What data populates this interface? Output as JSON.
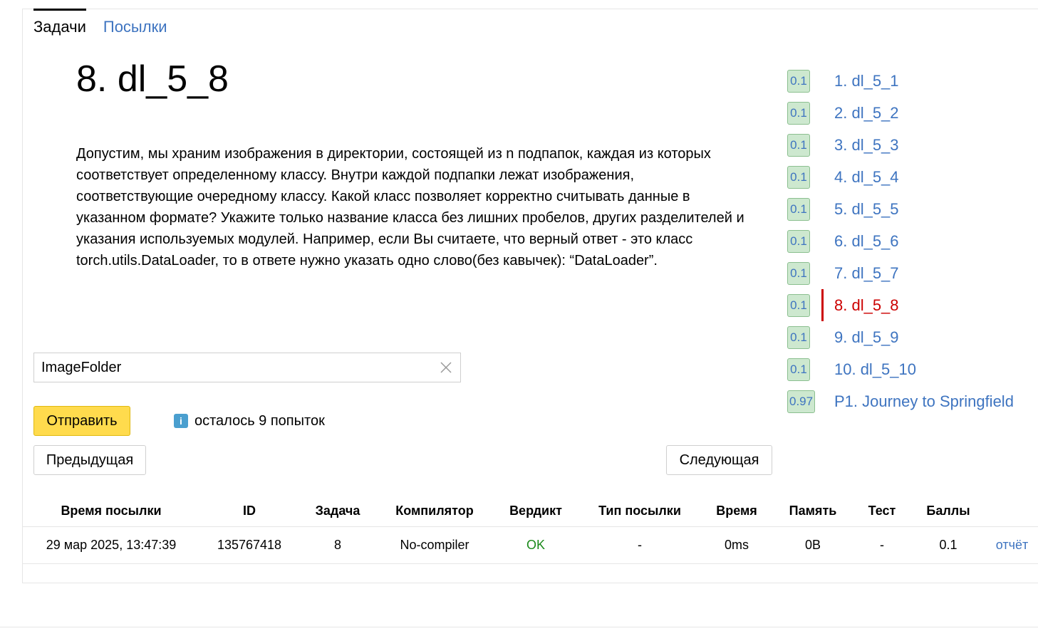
{
  "tabs": {
    "problems": "Задачи",
    "submissions": "Посылки"
  },
  "problem": {
    "title": "8. dl_5_8",
    "statement": "Допустим, мы храним изображения в директории, состоящей из n подпапок, каждая из которых соответствует определенному классу. Внутри каждой подпапки лежат изображения, соответствующие очередному классу. Какой класс позволяет корректно считывать данные в указанном формате? Укажите только название класса без лишних пробелов, других разделителей и указания используемых модулей. Например, если Вы считаете, что верный ответ - это класс torch.utils.DataLoader, то в ответе нужно указать одно слово(без кавычек): “DataLoader”."
  },
  "answer": {
    "value": "ImageFolder"
  },
  "actions": {
    "submit_label": "Отправить",
    "attempts_text": "осталось 9 попыток",
    "prev_label": "Предыдущая",
    "next_label": "Следующая"
  },
  "sidebar": {
    "items": [
      {
        "score": "0.1",
        "label": "1. dl_5_1"
      },
      {
        "score": "0.1",
        "label": "2. dl_5_2"
      },
      {
        "score": "0.1",
        "label": "3. dl_5_3"
      },
      {
        "score": "0.1",
        "label": "4. dl_5_4"
      },
      {
        "score": "0.1",
        "label": "5. dl_5_5"
      },
      {
        "score": "0.1",
        "label": "6. dl_5_6"
      },
      {
        "score": "0.1",
        "label": "7. dl_5_7"
      },
      {
        "score": "0.1",
        "label": "8. dl_5_8",
        "current": true
      },
      {
        "score": "0.1",
        "label": "9. dl_5_9"
      },
      {
        "score": "0.1",
        "label": "10. dl_5_10"
      },
      {
        "score": "0.97",
        "label": "P1. Journey to Springfield"
      }
    ]
  },
  "table": {
    "headers": [
      "Время посылки",
      "ID",
      "Задача",
      "Компилятор",
      "Вердикт",
      "Тип посылки",
      "Время",
      "Память",
      "Тест",
      "Баллы",
      ""
    ],
    "rows": [
      [
        "29 мар 2025, 13:47:39",
        "135767418",
        "8",
        "No-compiler",
        "OK",
        "-",
        "0ms",
        "0B",
        "-",
        "0.1",
        "отчёт"
      ]
    ]
  },
  "colors": {
    "link": "#3e74c0",
    "current": "#cc0000",
    "ok": "#1a8a1a",
    "submit": "#ffdb4d",
    "badge": "#cde8cf"
  }
}
